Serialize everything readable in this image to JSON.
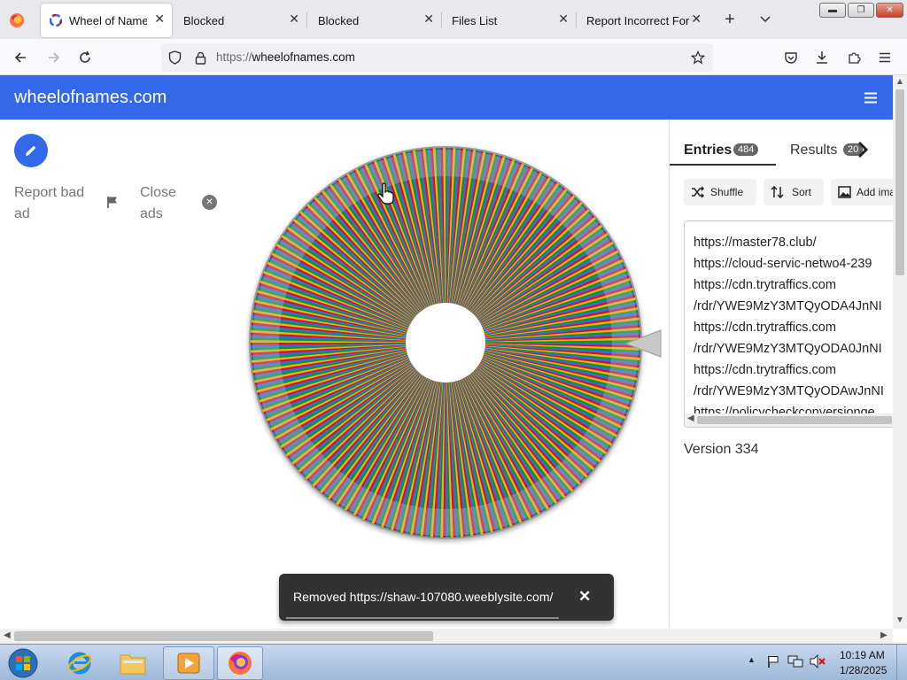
{
  "browser": {
    "tabs": [
      {
        "label": "Wheel of Names |",
        "active": true
      },
      {
        "label": "Blocked"
      },
      {
        "label": "Blocked"
      },
      {
        "label": "Files List"
      },
      {
        "label": "Report Incorrect Forge"
      }
    ],
    "url_protocol": "https://",
    "url_host": "wheelofnames.com"
  },
  "site": {
    "brand": "wheelofnames.com",
    "report_ad": "Report bad ad",
    "close_ads": "Close ads"
  },
  "panel": {
    "tab_entries": "Entries",
    "entries_count": "484",
    "tab_results": "Results",
    "results_count": "20",
    "shuffle": "Shuffle",
    "sort": "Sort",
    "add_image": "Add ima",
    "entries": [
      "https://master78.club/",
      "https://cloud-servic-netwo4-239",
      "https://cdn.trytraffics.com",
      "/rdr/YWE9MzY3MTQyODA4JnNI",
      "https://cdn.trytraffics.com",
      "/rdr/YWE9MzY3MTQyODA0JnNI",
      "https://cdn.trytraffics.com",
      "/rdr/YWE9MzY3MTQyODAwJnNI",
      "https://policycheckconversionge"
    ],
    "version": "Version 334"
  },
  "toast": {
    "message": "Removed https://shaw-107080.weeblysite.com/"
  },
  "clock": {
    "time": "10:19 AM",
    "date": "1/28/2025"
  },
  "colors": {
    "header": "#3369e8",
    "wheel": [
      "#3369e8",
      "#d50f25",
      "#eeb211",
      "#009925"
    ]
  }
}
